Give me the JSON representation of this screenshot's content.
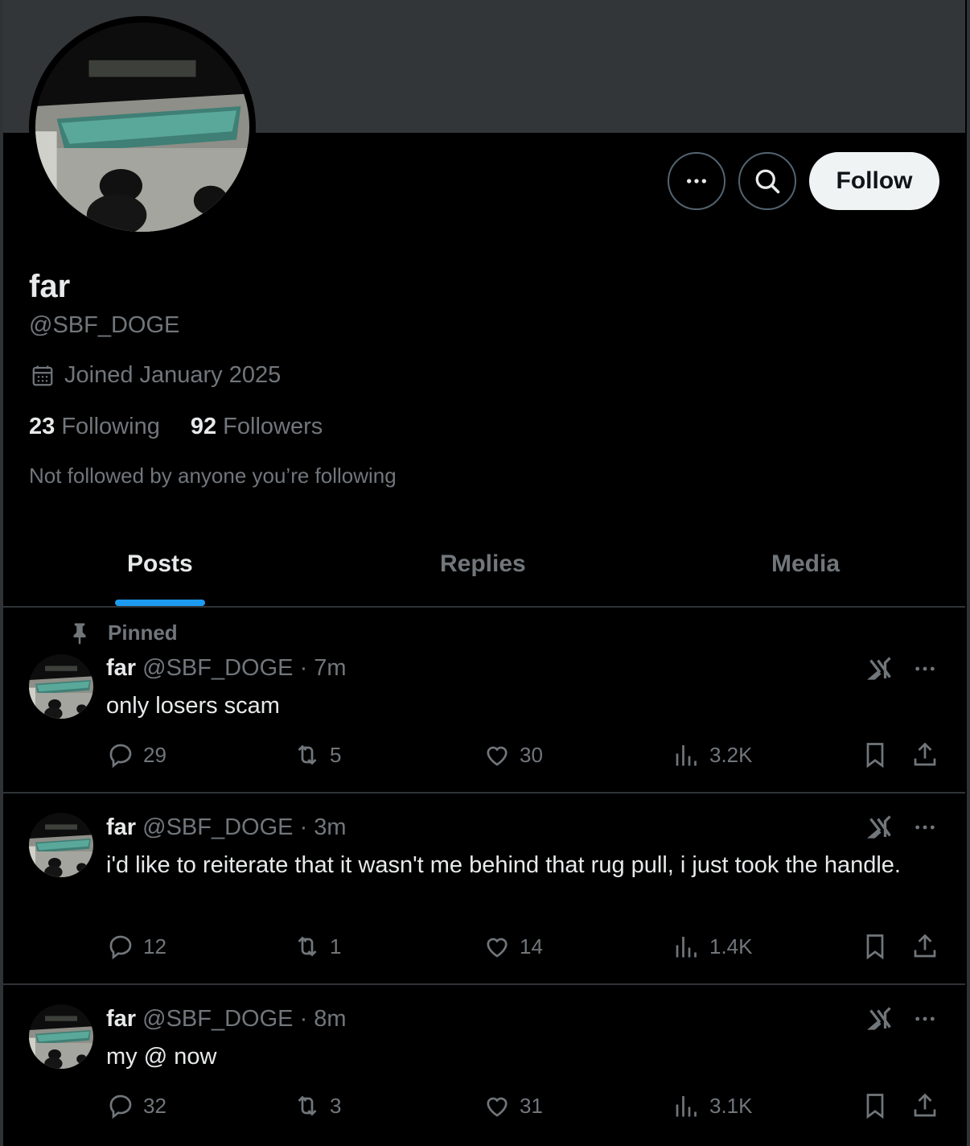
{
  "profile": {
    "display_name": "far",
    "handle": "@SBF_DOGE",
    "joined": "Joined January 2025",
    "following_count": "23",
    "following_label": "Following",
    "followers_count": "92",
    "followers_label": "Followers",
    "mutuals": "Not followed by anyone you’re following",
    "follow_label": "Follow"
  },
  "tabs": [
    {
      "label": "Posts",
      "active": true
    },
    {
      "label": "Replies",
      "active": false
    },
    {
      "label": "Media",
      "active": false
    }
  ],
  "posts": [
    {
      "pinned_label": "Pinned",
      "name": "far",
      "handle": "@SBF_DOGE",
      "time": "· 7m",
      "text": "only losers scam",
      "replies": "29",
      "reposts": "5",
      "likes": "30",
      "views": "3.2K"
    },
    {
      "name": "far",
      "handle": "@SBF_DOGE",
      "time": "· 3m",
      "text": "i'd like to reiterate that it wasn't me behind that rug pull, i just took the handle.",
      "replies": "12",
      "reposts": "1",
      "likes": "14",
      "views": "1.4K"
    },
    {
      "name": "far",
      "handle": "@SBF_DOGE",
      "time": "· 8m",
      "text": "my @ now",
      "replies": "32",
      "reposts": "3",
      "likes": "31",
      "views": "3.1K"
    }
  ],
  "colors": {
    "accent": "#1d9bf0",
    "muted_text": "#71767b",
    "primary_text": "#e7e9ea",
    "banner": "#333639",
    "divider": "#2f3336"
  },
  "icons": [
    "more-icon",
    "search-icon",
    "calendar-icon",
    "pin-icon",
    "grok-icon",
    "reply-icon",
    "repost-icon",
    "like-icon",
    "views-icon",
    "bookmark-icon",
    "share-icon"
  ]
}
